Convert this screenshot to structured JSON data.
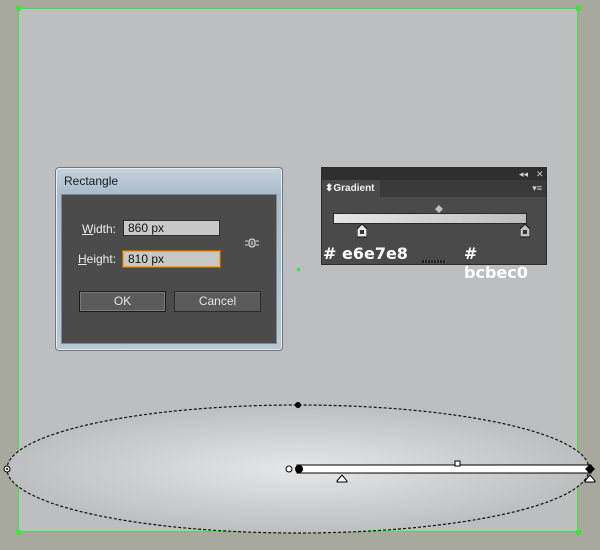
{
  "dialog": {
    "title": "Rectangle",
    "width_label_underlined": "W",
    "width_label_rest": "idth:",
    "height_label_underlined": "H",
    "height_label_rest": "eight:",
    "width_value": "860 px",
    "height_value": "810 px",
    "ok_label": "OK",
    "cancel_label": "Cancel",
    "link_icon": "link-proportions-icon"
  },
  "gradient_panel": {
    "tab_label": "Gradient",
    "collapse_icon": "collapse-icon",
    "close_icon": "close-icon",
    "menu_icon": "panel-menu-icon",
    "start_color_label": "# e6e7e8",
    "end_color_label": "# bcbec0",
    "start_color": "#e6e7e8",
    "end_color": "#bcbec0"
  },
  "colors": {
    "artboard": "#bcbec0",
    "pasteboard": "#a7a99d",
    "artboard_border": "#39e639"
  }
}
